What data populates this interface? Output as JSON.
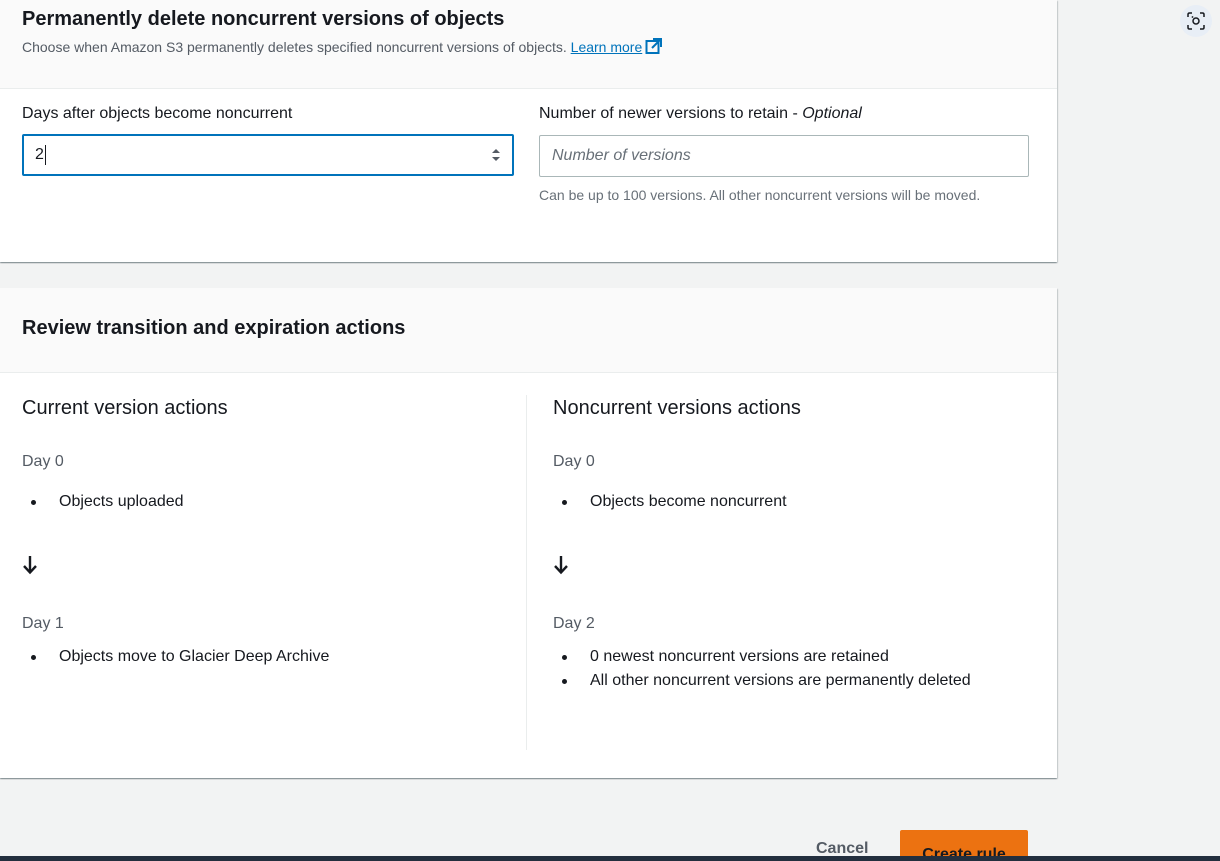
{
  "delete_section": {
    "title": "Permanently delete noncurrent versions of objects",
    "description": "Choose when Amazon S3 permanently deletes specified noncurrent versions of objects.",
    "learn_more": "Learn more",
    "days_field": {
      "label": "Days after objects become noncurrent",
      "value": "2"
    },
    "versions_field": {
      "label": "Number of newer versions to retain - ",
      "label_optional": "Optional",
      "placeholder": "Number of versions",
      "hint": "Can be up to 100 versions. All other noncurrent versions will be moved."
    }
  },
  "review_section": {
    "title": "Review transition and expiration actions",
    "current": {
      "title": "Current version actions",
      "step1_day": "Day 0",
      "step1_items": [
        "Objects uploaded"
      ],
      "step2_day": "Day 1",
      "step2_items": [
        "Objects move to Glacier Deep Archive"
      ]
    },
    "noncurrent": {
      "title": "Noncurrent versions actions",
      "step1_day": "Day 0",
      "step1_items": [
        "Objects become noncurrent"
      ],
      "step2_day": "Day 2",
      "step2_items": [
        "0 newest noncurrent versions are retained",
        "All other noncurrent versions are permanently deleted"
      ]
    }
  },
  "footer": {
    "cancel_label": "Cancel",
    "create_label": "Create rule"
  },
  "colors": {
    "primary_button": "#ec7211",
    "link": "#0073bb",
    "focus_border": "#0073bb",
    "bottom_bar": "#232f3e"
  },
  "icons": {
    "external_link": "external-link-icon",
    "arrow_down": "arrow-down-icon",
    "spinner": "number-spinner-icon",
    "scan": "visual-search-icon"
  }
}
